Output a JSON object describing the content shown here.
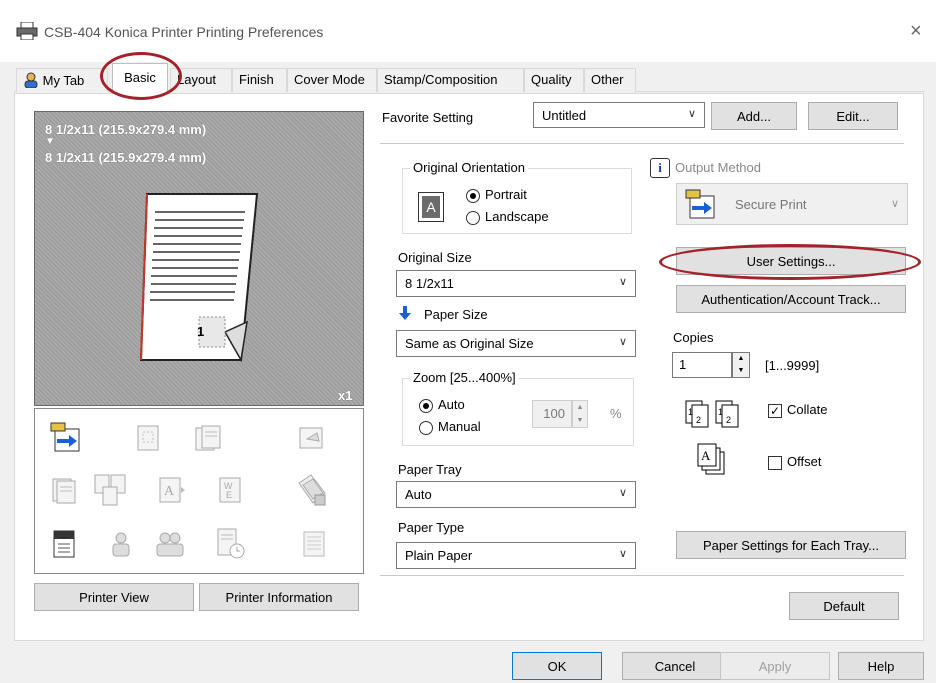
{
  "window": {
    "title": "CSB-404 Konica Printer Printing Preferences",
    "close_glyph": "×"
  },
  "tabs": [
    {
      "label": "My Tab"
    },
    {
      "label": "Basic"
    },
    {
      "label": "Layout"
    },
    {
      "label": "Finish"
    },
    {
      "label": "Cover Mode"
    },
    {
      "label": "Stamp/Composition"
    },
    {
      "label": "Quality"
    },
    {
      "label": "Other"
    }
  ],
  "preview": {
    "original_size_line": "8 1/2x11 (215.9x279.4 mm)",
    "arrow": "▼",
    "output_size_line": "8 1/2x11 (215.9x279.4 mm)",
    "page_number": "1",
    "copies_indicator": "x1"
  },
  "left_buttons": {
    "printer_view": "Printer View",
    "printer_information": "Printer Information"
  },
  "favorite": {
    "label": "Favorite Setting",
    "value": "Untitled",
    "add": "Add...",
    "edit": "Edit..."
  },
  "orientation": {
    "legend": "Original Orientation",
    "icon_letter": "A",
    "portrait": "Portrait",
    "landscape": "Landscape",
    "selected": "Portrait"
  },
  "original_size": {
    "label": "Original Size",
    "value": "8 1/2x11"
  },
  "paper_size": {
    "label": "Paper Size",
    "value": "Same as Original Size"
  },
  "zoom": {
    "legend": "Zoom [25...400%]",
    "auto": "Auto",
    "manual": "Manual",
    "selected": "Auto",
    "value": "100",
    "unit": "%"
  },
  "paper_tray": {
    "label": "Paper Tray",
    "value": "Auto"
  },
  "paper_type": {
    "label": "Paper Type",
    "value": "Plain Paper"
  },
  "output_method": {
    "label": "Output Method",
    "value": "Secure Print",
    "info_glyph": "i"
  },
  "right_buttons": {
    "user_settings": "User Settings...",
    "authentication": "Authentication/Account Track...",
    "paper_settings_each_tray": "Paper Settings for Each Tray...",
    "default": "Default"
  },
  "copies": {
    "label": "Copies",
    "value": "1",
    "range": "[1...9999]"
  },
  "collate": {
    "label": "Collate",
    "checked": true,
    "check_glyph": "✓"
  },
  "offset": {
    "label": "Offset",
    "checked": false
  },
  "dialog_buttons": {
    "ok": "OK",
    "cancel": "Cancel",
    "apply": "Apply",
    "help": "Help"
  },
  "colors": {
    "highlight_ring": "#a3232b",
    "preview_bg": "#9e9e9e",
    "arrow_blue": "#1a5fd6"
  },
  "function_icons": [
    "secure-print-icon",
    "booklet-icon",
    "staple-icon",
    "punch-icon",
    "copy-icon",
    "combination-icon",
    "stamp-icon",
    "watermark-icon",
    "overlay-icon",
    "user-settings-icon",
    "user-auth-icon",
    "account-track-icon",
    "schedule-icon",
    "filing-icon"
  ]
}
